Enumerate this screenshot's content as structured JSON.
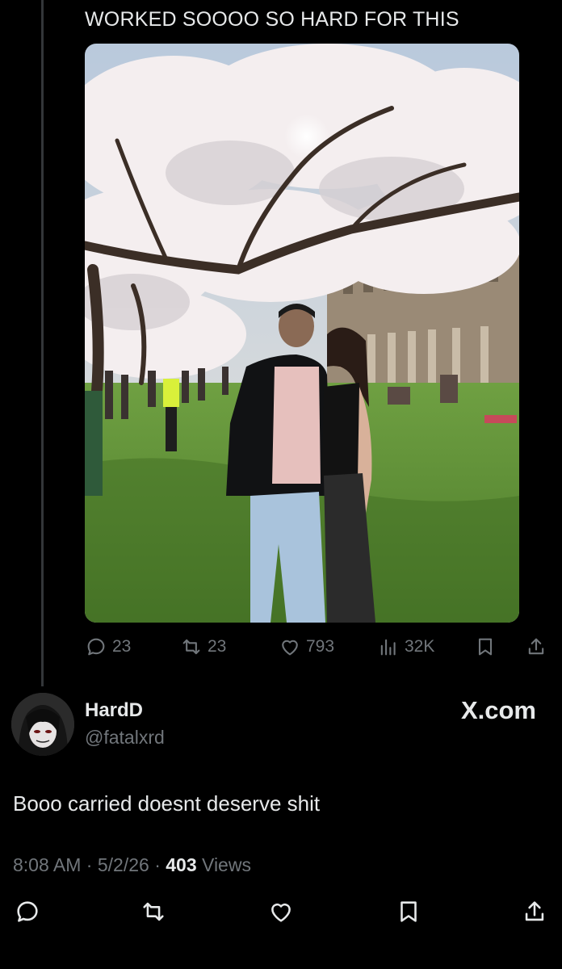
{
  "quoted_tweet": {
    "text": "WORKED SOOOO SO HARD FOR THIS",
    "image_alt": "Couple standing under blooming cherry trees on a campus lawn",
    "metrics": {
      "replies": "23",
      "reposts": "23",
      "likes": "793",
      "views": "32K"
    },
    "icons": [
      "reply-icon",
      "repost-icon",
      "like-icon",
      "views-icon",
      "bookmark-icon",
      "share-icon"
    ]
  },
  "reply": {
    "display_name": "HardD",
    "handle": "@fatalxrd",
    "watermark": "X.com",
    "text": "Booo carried doesnt deserve shit",
    "time": "8:08 AM",
    "separator": "·",
    "date": "5/2/26",
    "views_count": "403",
    "views_label": "Views"
  },
  "colors": {
    "background": "#000000",
    "text": "#e7e9ea",
    "muted": "#71767b",
    "thread_line": "#333639"
  }
}
